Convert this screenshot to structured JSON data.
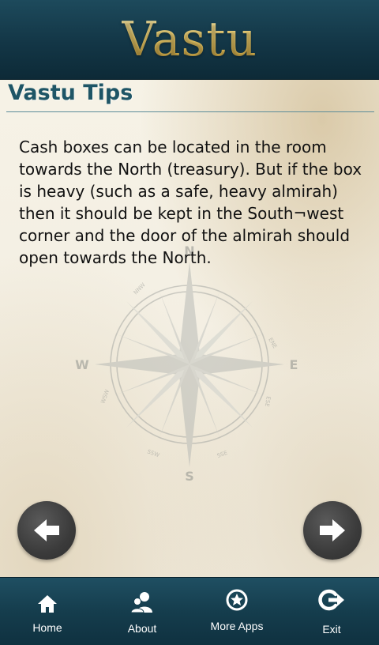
{
  "header": {
    "title": "Vastu"
  },
  "section": {
    "title": "Vastu Tips"
  },
  "tip": {
    "text": "Cash boxes can be located in the room towards the North (treasury). But if the box is heavy (such as a safe, heavy almirah) then it should be kept in the South¬west corner and the door of the almirah should open towards the North."
  },
  "compass": {
    "north": "N",
    "west": "W",
    "east": "E",
    "south": "S",
    "nnw": "NNW",
    "ene": "ENE",
    "ese": "ESE",
    "ssw": "SSW",
    "sse": "SSE",
    "wsw": "WSW"
  },
  "nav": {
    "prev_icon": "arrow-left-icon",
    "next_icon": "arrow-right-icon"
  },
  "tabs": [
    {
      "label": "Home",
      "icon": "home-icon"
    },
    {
      "label": "About",
      "icon": "people-icon"
    },
    {
      "label": "More Apps",
      "icon": "star-icon"
    },
    {
      "label": "Exit",
      "icon": "exit-icon"
    }
  ],
  "colors": {
    "header_bg": "#133646",
    "title_gold": "#e7c96b",
    "section_title": "#1e5566",
    "tabbar_bg": "#153d4d",
    "nav_button": "#3b3b3b"
  }
}
